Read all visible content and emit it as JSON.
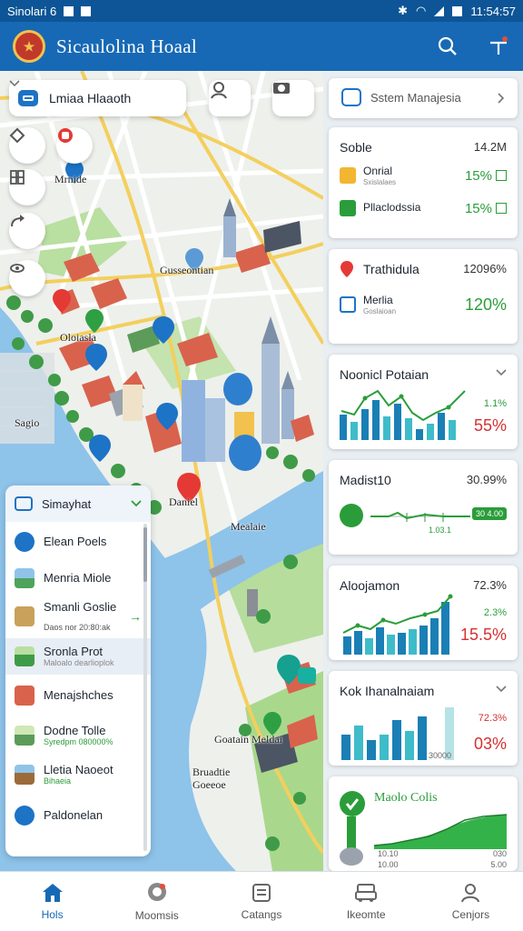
{
  "status_bar": {
    "left_text": "Sinolari 6",
    "time": "11:54:57"
  },
  "app": {
    "title": "Sicaulolina Hoaal",
    "logo_glyph": "★"
  },
  "map": {
    "location_select": {
      "label": "Lmiaa Hlaaoth"
    },
    "labels": {
      "poi1": "Mrnide",
      "poi2": "Gusseontian",
      "poi3": "Oloiasla",
      "poi4": "Sagio",
      "poi5": "Daniel",
      "poi6": "Mealaie",
      "poi7": "Goatain Meldai",
      "poi8": "Bruadtie\nGoeeoe"
    }
  },
  "list_panel": {
    "header": "Simayhat",
    "items": [
      {
        "label": "Elean Poels",
        "sub": "",
        "icon": "pool-icon"
      },
      {
        "label": "Menria Miole",
        "sub": "",
        "icon": "landscape-icon"
      },
      {
        "label": "Smanli Goslie",
        "sub": "Daos nor 20:80:ak",
        "icon": "building-icon"
      },
      {
        "label": "Sronla Prot",
        "sub": "Maloalo dearlioplok",
        "icon": "park-icon"
      },
      {
        "label": "Menajshches",
        "sub": "",
        "icon": "store-icon"
      },
      {
        "label": "Dodne Tolle",
        "sub": "Syredpm 080000%",
        "icon": "field-icon"
      },
      {
        "label": "Lletia Naoeot",
        "sub": "Bihaeia",
        "icon": "museum-icon"
      },
      {
        "label": "Paldonelan",
        "sub": "",
        "icon": "globe-icon"
      }
    ]
  },
  "cards": {
    "system": {
      "label": "Sstem Manajesia"
    },
    "stats": {
      "title": "Soble",
      "value": "14.2M",
      "rows": [
        {
          "title": "Onrial",
          "sub": "Sxislalaes",
          "pct": "15%"
        },
        {
          "title": "Pllaclodssia",
          "sub": "",
          "pct": "15%"
        }
      ]
    },
    "trend": {
      "title": "Trathidula",
      "value": "12096%",
      "row_title": "Merlia",
      "row_sub": "Goslaioan",
      "pct": "120%"
    },
    "chart1": {
      "title": "Noonicl Potaian",
      "top": "1.1%",
      "big": "55%"
    },
    "chart2": {
      "title": "Madist10",
      "value": "30.99%",
      "tag": "1.03.1",
      "badge": "30 4.00"
    },
    "chart3": {
      "title": "Aloojamon",
      "top": "72.3%",
      "mid": "2.3%",
      "big": "15.5%"
    },
    "chart4": {
      "title": "Kok Ihanalnaiam",
      "top": "72.3%",
      "axis": "30000",
      "big": "03%"
    },
    "chart5": {
      "title": "Maolo Colis",
      "axis_left": "10.10",
      "axis_right": "030",
      "axis_left2": "10.00",
      "axis_right2": "5.00"
    }
  },
  "bottom_nav": {
    "items": [
      {
        "label": "Hols",
        "icon": "home-icon"
      },
      {
        "label": "Moomsis",
        "icon": "pin-icon"
      },
      {
        "label": "Catangs",
        "icon": "list-icon"
      },
      {
        "label": "Ikeomte",
        "icon": "car-icon"
      },
      {
        "label": "Cenjors",
        "icon": "profile-icon"
      }
    ]
  }
}
